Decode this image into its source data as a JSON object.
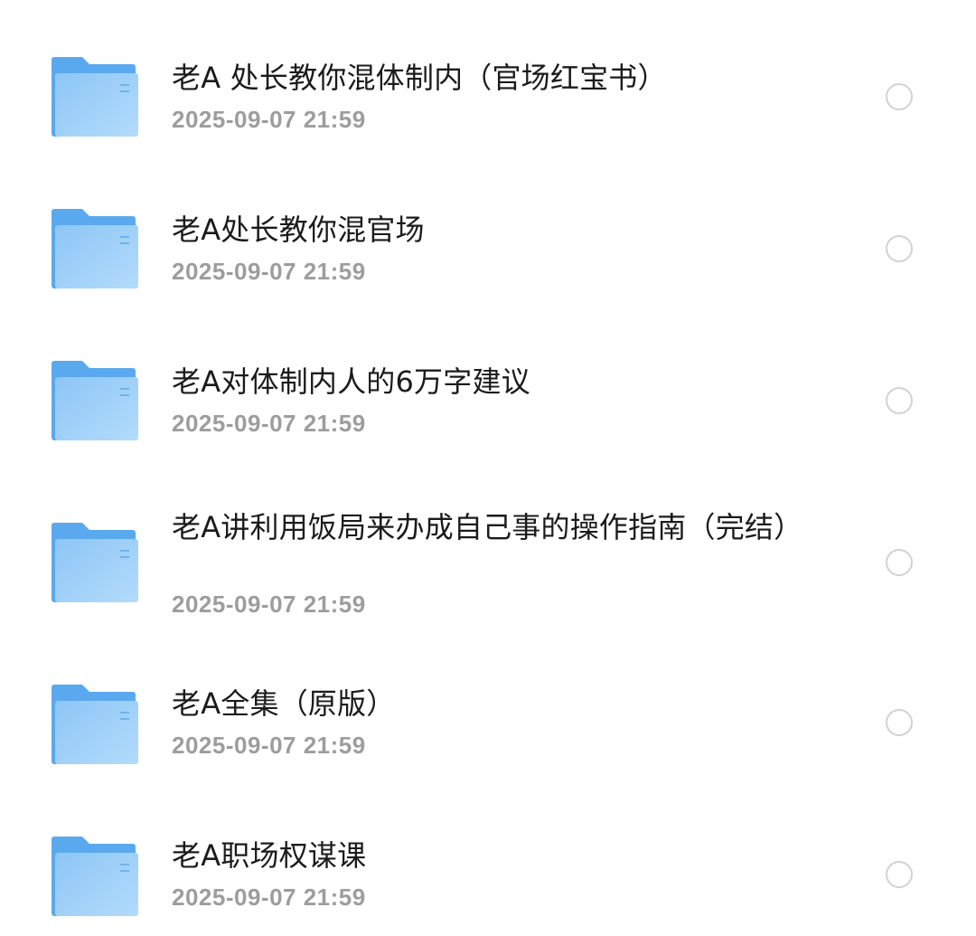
{
  "files": [
    {
      "name": "老A 处长教你混体制内（官场红宝书）",
      "date": "2025-09-07 21:59",
      "icon": "folder-icon"
    },
    {
      "name": "老A处长教你混官场",
      "date": "2025-09-07 21:59",
      "icon": "folder-icon"
    },
    {
      "name": "老A对体制内人的6万字建议",
      "date": "2025-09-07 21:59",
      "icon": "folder-icon"
    },
    {
      "name": "老A讲利用饭局来办成自己事的操作指南（完结）",
      "date": "2025-09-07 21:59",
      "icon": "folder-icon"
    },
    {
      "name": "老A全集（原版）",
      "date": "2025-09-07 21:59",
      "icon": "folder-icon"
    },
    {
      "name": "老A职场权谋课",
      "date": "2025-09-07 21:59",
      "icon": "folder-icon"
    }
  ],
  "colors": {
    "folder_back": "#5aa9ee",
    "folder_front_top": "#8ec6f6",
    "folder_front_bottom": "#b3dbfb",
    "title_text": "#1b1b1b",
    "date_text": "#9d9d9d",
    "select_circle": "#d2d2d2"
  }
}
